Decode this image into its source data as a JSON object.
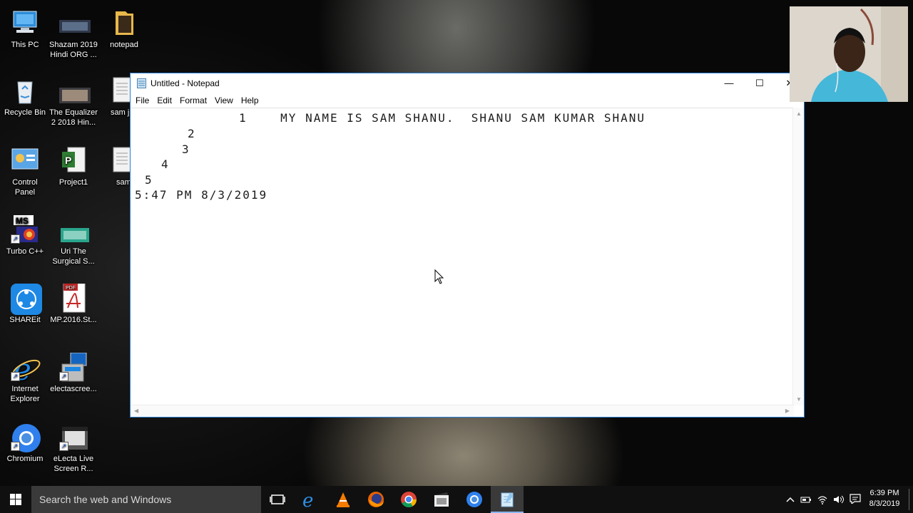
{
  "desktop": {
    "icons": [
      {
        "label": "This PC",
        "icon": "this-pc-icon"
      },
      {
        "label": "Shazam 2019\nHindi ORG ...",
        "icon": "video-file-icon"
      },
      {
        "label": "notepad",
        "icon": "folder-icon"
      },
      {
        "label": "Recycle Bin",
        "icon": "recycle-bin-icon"
      },
      {
        "label": "The Equalizer\n2 2018 Hin...",
        "icon": "video-file-icon"
      },
      {
        "label": "sam j",
        "icon": "text-file-icon"
      },
      {
        "label": "Control\nPanel",
        "icon": "control-panel-icon"
      },
      {
        "label": "Project1",
        "icon": "project-icon"
      },
      {
        "label": "sam",
        "icon": "text-file-icon"
      },
      {
        "label": "Turbo C++",
        "icon": "turbo-cpp-icon"
      },
      {
        "label": "Uri The\nSurgical S...",
        "icon": "video-file-icon"
      },
      {
        "label": "SHAREit",
        "icon": "shareit-icon"
      },
      {
        "label": "MP.2016.St...",
        "icon": "pdf-icon"
      },
      {
        "label": "Internet\nExplorer",
        "icon": "internet-explorer-icon"
      },
      {
        "label": "electascree...",
        "icon": "installer-icon"
      },
      {
        "label": "Chromium",
        "icon": "chromium-icon"
      },
      {
        "label": "eLecta Live\nScreen R...",
        "icon": "video-file-icon"
      }
    ]
  },
  "notepad": {
    "title": "Untitled - Notepad",
    "menu": [
      "File",
      "Edit",
      "Format",
      "View",
      "Help"
    ],
    "minimize_glyph": "—",
    "maximize_glyph": "☐",
    "close_glyph": "✕",
    "lines": [
      "1    MY NAME IS SAM SHANU.  SHANU SAM KUMAR SHANU",
      "2",
      "3",
      "4",
      "5",
      "5:47 PM 8/3/2019"
    ]
  },
  "taskbar": {
    "search_placeholder": "Search the web and Windows",
    "apps": [
      "task-view-icon",
      "edge-icon",
      "vlc-icon",
      "firefox-icon",
      "chrome-icon",
      "video-editor-icon",
      "chromium-icon",
      "notepad-icon"
    ],
    "time": "6:39 PM",
    "date": "8/3/2019"
  }
}
